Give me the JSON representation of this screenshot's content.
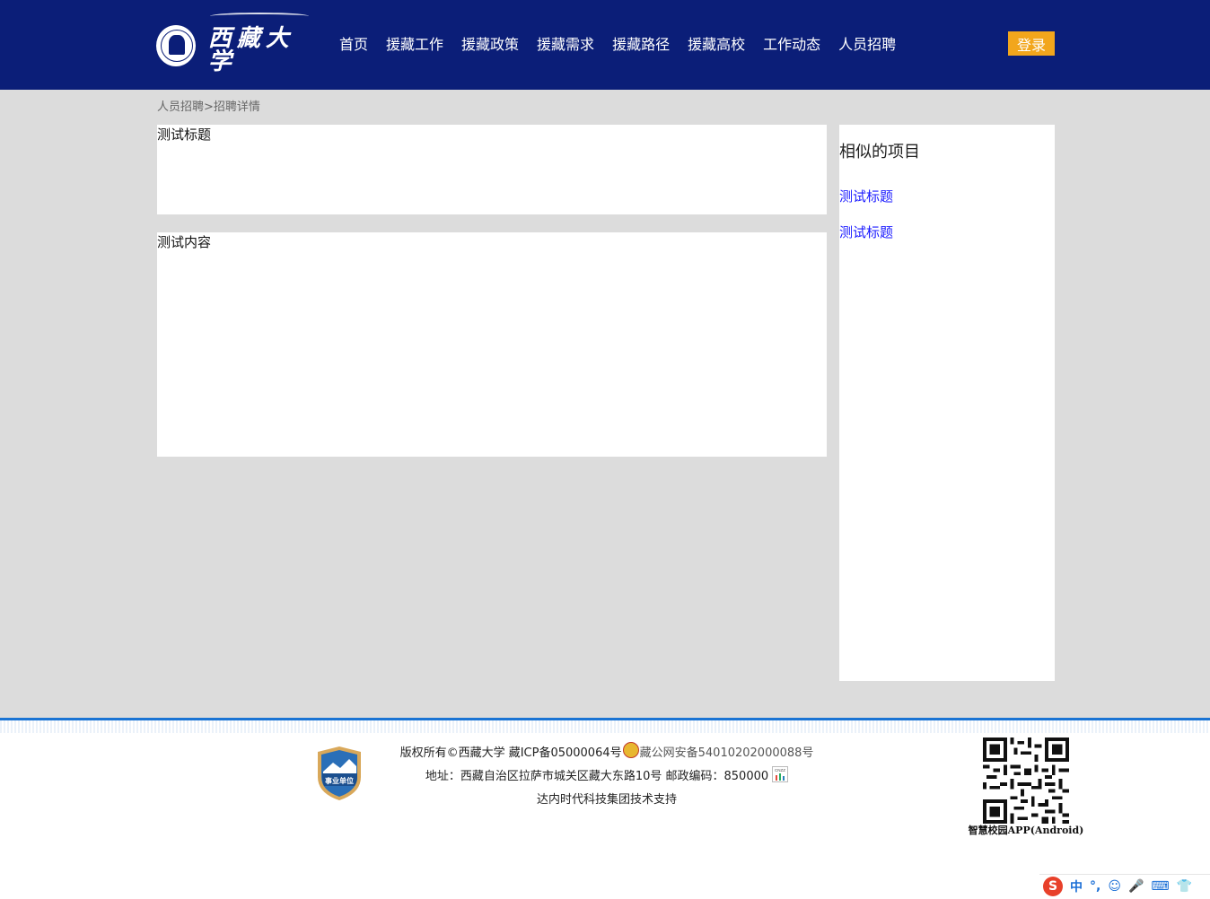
{
  "header": {
    "logo_text": "西藏大学",
    "nav": [
      {
        "label": "首页"
      },
      {
        "label": "援藏工作"
      },
      {
        "label": "援藏政策"
      },
      {
        "label": "援藏需求"
      },
      {
        "label": "援藏路径"
      },
      {
        "label": "援藏高校"
      },
      {
        "label": "工作动态"
      },
      {
        "label": "人员招聘"
      }
    ],
    "login_label": "登录"
  },
  "breadcrumb": {
    "parent": "人员招聘",
    "separator": ">",
    "current": "招聘详情"
  },
  "detail": {
    "title": "测试标题",
    "content": "测试内容"
  },
  "sidebar": {
    "title": "相似的项目",
    "items": [
      {
        "label": "测试标题"
      },
      {
        "label": "测试标题"
      }
    ]
  },
  "footer": {
    "copyright": "版权所有©西藏大学 藏ICP备05000064号",
    "police_record": "藏公网安备54010202000088号",
    "address": "地址：西藏自治区拉萨市城关区藏大东路10号 邮政编码：850000",
    "support": "达内时代科技集团技术支持",
    "badge_text": "事业单位",
    "qr_caption": "智慧校园APP(Android)",
    "cnzz_text": "CNZZ"
  },
  "ime": {
    "logo": "S",
    "items": [
      "中",
      "°,",
      "☺",
      "🎤",
      "⌨",
      "👕"
    ]
  },
  "colors": {
    "header_bg": "#0b1e78",
    "login_bg": "#f2a61c",
    "link": "#1a1aff",
    "footer_border": "#1a74d4"
  }
}
